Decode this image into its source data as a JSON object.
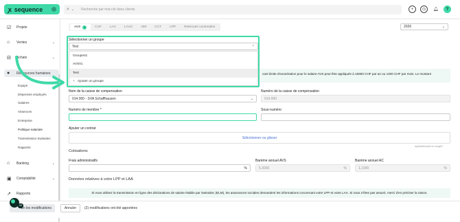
{
  "brand": {
    "name": "sequence",
    "colors": {
      "accent": "#3fd9a8",
      "dark": "#0d2a24",
      "link": "#4a6fd3"
    }
  },
  "search": {
    "placeholder": "Recherche par mot-clé dans clients",
    "icon": "search-icon"
  },
  "top_icons": [
    "plus-circle-icon",
    "clock-icon",
    "bell-icon",
    "help-icon"
  ],
  "top_help_label": "?",
  "sidebar": {
    "items": [
      {
        "label": "Projets",
        "icon": "projects-icon"
      },
      {
        "label": "Ventes",
        "icon": "sales-icon"
      },
      {
        "label": "Achats",
        "icon": "purchases-icon"
      },
      {
        "label": "Ressources humaines",
        "icon": "hr-icon"
      },
      {
        "label": "Banking",
        "icon": "bank-icon"
      },
      {
        "label": "Comptabilité",
        "icon": "accounting-icon"
      },
      {
        "label": "Rapports",
        "icon": "reports-icon"
      }
    ],
    "subitems": [
      "Equipe",
      "Dépenses employés",
      "Salaires",
      "Absences",
      "Entreprise",
      "Politique salariale",
      "Transmission Swissdec",
      "Rapports"
    ]
  },
  "tabs": {
    "items": [
      "AVS",
      "CAF",
      "LAA",
      "LAAC",
      "IJM",
      "CCT",
      "LPP",
      "Retenues cantonales"
    ],
    "active_badge": "1"
  },
  "year": {
    "value": "2026"
  },
  "group": {
    "label": "Sélectionner un groupe",
    "value": "Test",
    "options": [
      "Groupe01",
      "AVS01",
      "Test"
    ],
    "add_label": "Ajouter un groupe"
  },
  "info": {
    "text": "cant limite d'exonération pour le salaire AVS peut être appliquée à 16800 CHF par an ou 1400 CHF par mois. Le montant"
  },
  "caisse": {
    "name_label": "Nom de la caisse de compensation",
    "name_value": "014.000 - SVA Schaffhausen",
    "number_label": "Numéro de la caisse de compensation",
    "number_value": "014.000"
  },
  "membre": {
    "label": "Numéro de membre *",
    "value": ""
  },
  "sous": {
    "label": "Sous-numéro",
    "value": ""
  },
  "contrat": {
    "label": "Ajouter un contrat",
    "upload_text": "Sélectionner ou glisser",
    "hint": "application/pdf ou image/*"
  },
  "cotisations": {
    "title": "Cotisations",
    "frais_label": "Frais administratifs",
    "frais_unit": "%",
    "avs_label": "Barème annuel AVS",
    "avs_value": "5,3000",
    "avs_unit": "%",
    "ac_label": "Barème annuel AC",
    "ac_value": "1,1000",
    "ac_unit": "%"
  },
  "lpp": {
    "title": "Données relatives à votre LPP et LAA",
    "info": "Si vous utilisez la transmission en ligne des déclarations de salaire établie par Swissdec (ELM), les assurances sociales demandent les informations concernant votre LPP et votre LAA. Si vous n'êtes pas assuré, merci d'en préciser la raison."
  },
  "footer": {
    "save_label": "les modifications",
    "save_prefix": "En",
    "cancel_label": "Annuler",
    "mods_text": "(2) modifications ont été apportées",
    "fab_badge": "99"
  }
}
